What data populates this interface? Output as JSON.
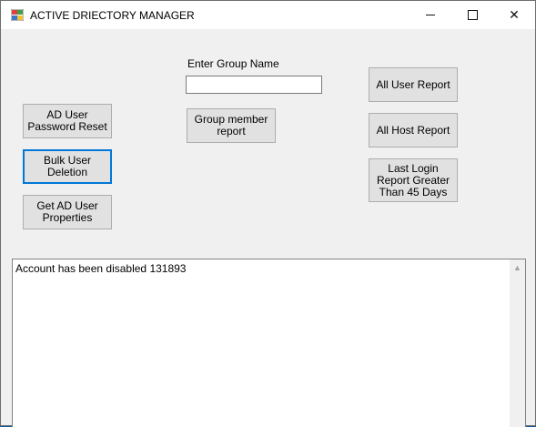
{
  "window": {
    "title": "ACTIVE DRIECTORY MANAGER",
    "minimize_icon": "minimize-icon",
    "maximize_icon": "maximize-icon",
    "close_glyph": "✕"
  },
  "left_buttons": {
    "password_reset": "AD User Password Reset",
    "bulk_delete": "Bulk User Deletion",
    "get_properties": "Get AD User Properties"
  },
  "group": {
    "label": "Enter Group Name",
    "input_value": "",
    "report_button": "Group member report"
  },
  "right_buttons": {
    "all_user_report": "All User Report",
    "all_host_report": "All Host Report",
    "last_login_report": "Last Login Report Greater Than 45 Days"
  },
  "output": {
    "text": "Account has been disabled 131893",
    "scroll_up_glyph": "▲"
  },
  "colors": {
    "accent": "#0078d7",
    "button_face": "#e1e1e1",
    "window_bg": "#f0f0f0"
  }
}
